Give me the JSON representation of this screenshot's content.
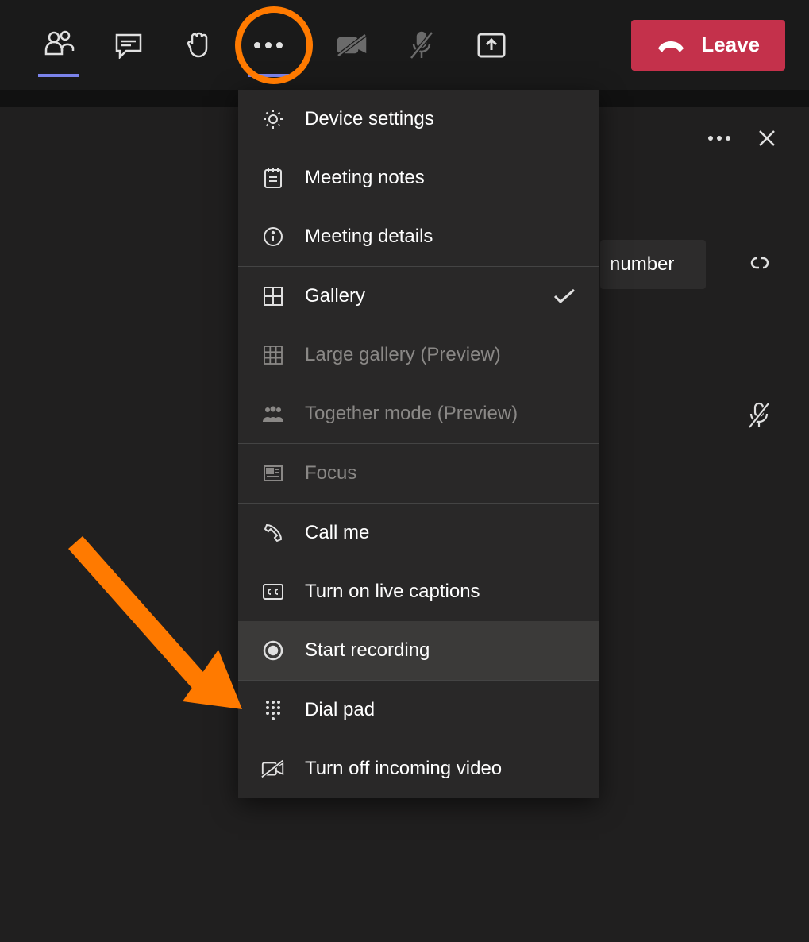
{
  "toolbar": {
    "leave_label": "Leave"
  },
  "sidepanel": {
    "pill_text": "number"
  },
  "menu": {
    "device_settings": "Device settings",
    "meeting_notes": "Meeting notes",
    "meeting_details": "Meeting details",
    "gallery": "Gallery",
    "large_gallery": "Large gallery (Preview)",
    "together_mode": "Together mode (Preview)",
    "focus": "Focus",
    "call_me": "Call me",
    "live_captions": "Turn on live captions",
    "start_recording": "Start recording",
    "dial_pad": "Dial pad",
    "turn_off_video": "Turn off incoming video"
  }
}
